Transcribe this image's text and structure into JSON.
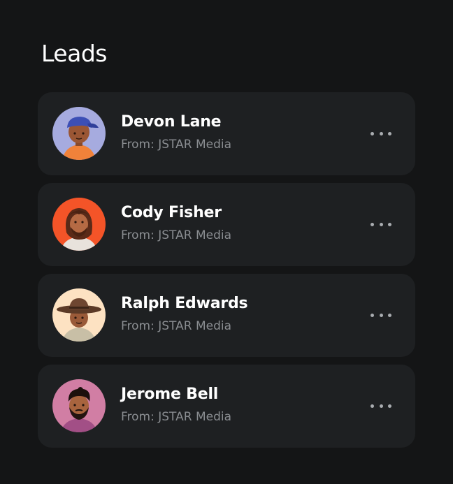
{
  "header": {
    "title": "Leads"
  },
  "leads": [
    {
      "name": "Devon Lane",
      "source": "From: JSTAR Media",
      "avatar_icon": "avatar-boy-blue-cap",
      "avatar_bg": "#a6abdf"
    },
    {
      "name": "Cody Fisher",
      "source": "From: JSTAR Media",
      "avatar_icon": "avatar-man-long-hair",
      "avatar_bg": "#f45428"
    },
    {
      "name": "Ralph Edwards",
      "source": "From: JSTAR Media",
      "avatar_icon": "avatar-cowboy-hat",
      "avatar_bg": "#fde2c2"
    },
    {
      "name": "Jerome Bell",
      "source": "From: JSTAR Media",
      "avatar_icon": "avatar-man-beard",
      "avatar_bg": "#d17ea4"
    }
  ],
  "colors": {
    "page_bg": "#141516",
    "card_bg": "#1e2022",
    "secondary_text": "#8a8d91",
    "menu_dots": "#a9acb0"
  }
}
